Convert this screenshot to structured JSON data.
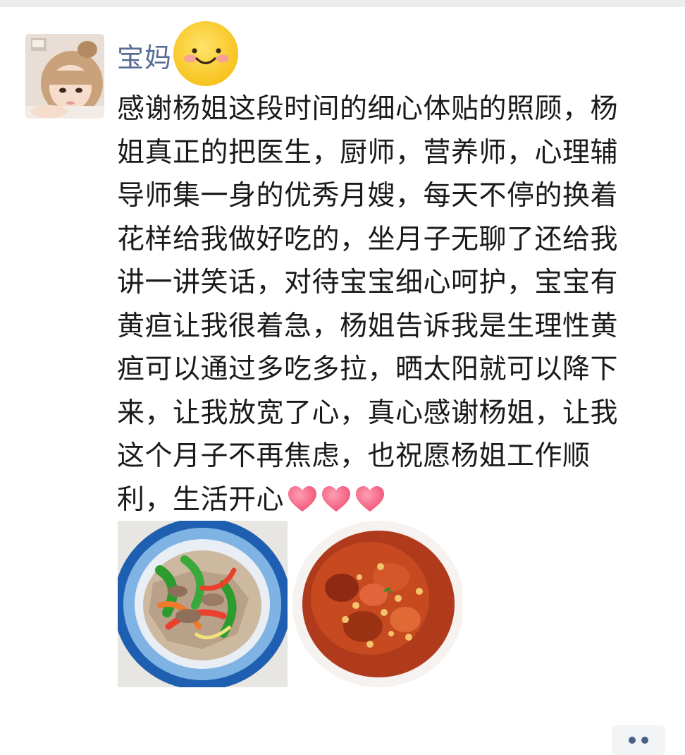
{
  "post": {
    "username": "宝妈",
    "message": "感谢杨姐这段时间的细心体贴的照顾，杨姐真正的把医生，厨师，营养师，心理辅导师集一身的优秀月嫂，每天不停的换着花样给我做好吃的，坐月子无聊了还给我讲一讲笑话，对待宝宝细心呵护，宝宝有黄疸让我很着急，杨姐告诉我是生理性黄疸可以通过多吃多拉，晒太阳就可以降下来，让我放宽了心，真心感谢杨姐，让我这个月子不再焦虑，也祝愿杨姐工作顺利，生活开心",
    "message_lines": [
      "感谢杨姐这段时间的细心体贴的照顾，杨",
      "姐真正的把医生，厨师，营养师，心理辅",
      "导师集一身的优秀月嫂，每天不停的换着",
      "花样给我做好吃的，坐月子无聊了还给我",
      "讲一讲笑话，对待宝宝细心呵护，宝宝有",
      "黄疸让我很着急，杨姐告诉我是生理性黄",
      "疸可以通过多吃多拉，晒太阳就可以降下",
      "来，让我放宽了心，真心感谢杨姐，让我",
      "这个月子不再焦虑，也祝愿杨姐工作顺",
      "利，生活开心"
    ],
    "emoji_after_name": "smile-emoji",
    "trailing_emojis": [
      "heart-emoji",
      "heart-emoji",
      "heart-emoji"
    ],
    "images": [
      {
        "name": "stir-fried-pork-with-peppers-photo"
      },
      {
        "name": "braised-pork-with-soybeans-photo"
      }
    ]
  },
  "colors": {
    "username": "#576b95",
    "text": "#1a1a1a",
    "more_button_bg": "#f2f3f5",
    "more_button_dots": "#4a5f87"
  },
  "icons": {
    "more": "more-dots-icon"
  }
}
